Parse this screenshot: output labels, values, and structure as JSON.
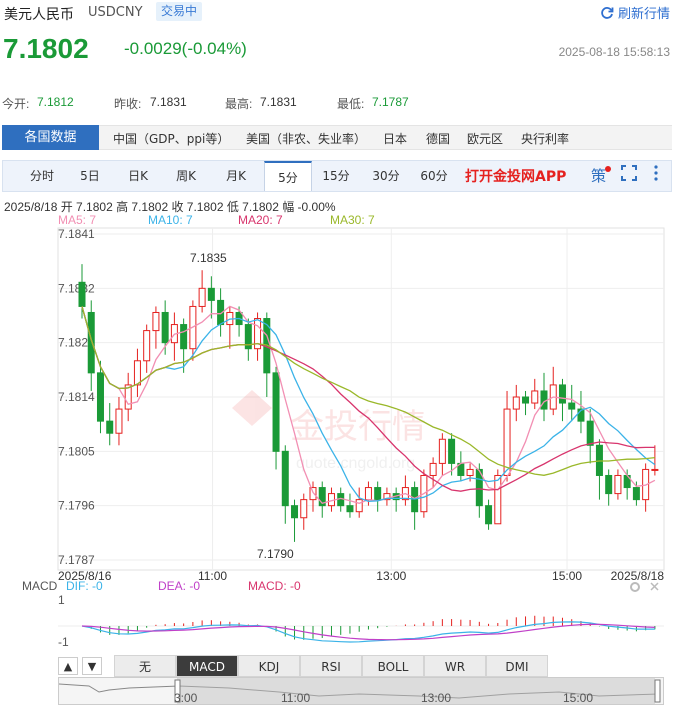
{
  "header": {
    "title": "美元人民币",
    "code": "USDCNY",
    "badge": "交易中",
    "refresh": "刷新行情"
  },
  "quote": {
    "price": "7.1802",
    "change": "-0.0029(-0.04%)",
    "timestamp": "2025-08-18 15:58:13"
  },
  "stats": {
    "open_label": "今开:",
    "open": "7.1812",
    "prev_label": "昨收:",
    "prev": "7.1831",
    "high_label": "最高:",
    "high": "7.1831",
    "low_label": "最低:",
    "low": "7.1787"
  },
  "nav": {
    "active": "各国数据",
    "items": [
      "中国（GDP、ppi等）",
      "美国（非农、失业率）",
      "日本",
      "德国",
      "欧元区",
      "央行利率"
    ]
  },
  "tabs": {
    "items": [
      "分时",
      "5日",
      "日K",
      "周K",
      "月K",
      "5分",
      "15分",
      "30分",
      "60分"
    ],
    "selected": "5分",
    "app": "打开金投网APP",
    "ce": "策"
  },
  "ohlc": "2025/8/18  开 7.1802  高 7.1802  收 7.1802  低 7.1802  幅 -0.00%",
  "ma": {
    "ma5": "MA5: 7",
    "ma10": "MA10: 7",
    "ma20": "MA20: 7",
    "ma30": "MA30: 7"
  },
  "colors": {
    "up": "#e5211f",
    "down": "#1a9a37",
    "ma5": "#f28fb3",
    "ma10": "#3bb3e8",
    "ma20": "#d8356d",
    "ma30": "#9ab82a"
  },
  "watermark": {
    "brand": "金投行情",
    "url": "quote.cngold.org"
  },
  "chart_data": {
    "type": "candlestick",
    "ylim": [
      7.1787,
      7.1841
    ],
    "y_ticks": [
      "7.1841",
      "7.1832",
      "7.1823",
      "7.1814",
      "7.1805",
      "7.1796",
      "7.1787"
    ],
    "x_labels": [
      "2025/8/16",
      "11:00",
      "13:00",
      "15:00",
      "2025/8/18"
    ],
    "annotations": {
      "high": "7.1835",
      "low": "7.1790"
    },
    "candles": [
      [
        7.1833,
        7.1829,
        7.1836,
        7.1827
      ],
      [
        7.1828,
        7.1818,
        7.183,
        7.1815
      ],
      [
        7.1818,
        7.181,
        7.182,
        7.1808
      ],
      [
        7.181,
        7.1808,
        7.1813,
        7.1806
      ],
      [
        7.1808,
        7.1812,
        7.1814,
        7.1806
      ],
      [
        7.1812,
        7.1816,
        7.1818,
        7.181
      ],
      [
        7.1816,
        7.182,
        7.1822,
        7.1814
      ],
      [
        7.182,
        7.1825,
        7.1826,
        7.1818
      ],
      [
        7.1825,
        7.1828,
        7.1829,
        7.1822
      ],
      [
        7.1828,
        7.1823,
        7.183,
        7.1821
      ],
      [
        7.1823,
        7.1826,
        7.1828,
        7.182
      ],
      [
        7.1826,
        7.1822,
        7.1827,
        7.1818
      ],
      [
        7.1822,
        7.1829,
        7.183,
        7.182
      ],
      [
        7.1829,
        7.1832,
        7.1835,
        7.1828
      ],
      [
        7.1832,
        7.183,
        7.1834,
        7.1827
      ],
      [
        7.183,
        7.1826,
        7.1832,
        7.1824
      ],
      [
        7.1826,
        7.1828,
        7.1829,
        7.1822
      ],
      [
        7.1828,
        7.1826,
        7.1829,
        7.1824
      ],
      [
        7.1826,
        7.1822,
        7.1827,
        7.182
      ],
      [
        7.1822,
        7.1827,
        7.1828,
        7.182
      ],
      [
        7.1827,
        7.1818,
        7.1828,
        7.1814
      ],
      [
        7.1818,
        7.1805,
        7.1819,
        7.1802
      ],
      [
        7.1805,
        7.1796,
        7.1806,
        7.1793
      ],
      [
        7.1796,
        7.1794,
        7.1797,
        7.179
      ],
      [
        7.1794,
        7.1797,
        7.1798,
        7.1792
      ],
      [
        7.1797,
        7.1799,
        7.18,
        7.1795
      ],
      [
        7.1799,
        7.1796,
        7.18,
        7.1794
      ],
      [
        7.1796,
        7.1798,
        7.1799,
        7.1795
      ],
      [
        7.1798,
        7.1796,
        7.1799,
        7.1795
      ],
      [
        7.1796,
        7.1795,
        7.1798,
        7.1794
      ],
      [
        7.1795,
        7.1797,
        7.1799,
        7.1794
      ],
      [
        7.1797,
        7.1799,
        7.18,
        7.1796
      ],
      [
        7.1799,
        7.1797,
        7.18,
        7.1795
      ],
      [
        7.1797,
        7.1798,
        7.1799,
        7.1796
      ],
      [
        7.1798,
        7.1797,
        7.1799,
        7.1795
      ],
      [
        7.1797,
        7.1799,
        7.1801,
        7.1796
      ],
      [
        7.1799,
        7.1795,
        7.18,
        7.1792
      ],
      [
        7.1795,
        7.1801,
        7.1802,
        7.1794
      ],
      [
        7.1801,
        7.1803,
        7.1804,
        7.1799
      ],
      [
        7.1803,
        7.1807,
        7.1808,
        7.1801
      ],
      [
        7.1807,
        7.1803,
        7.1808,
        7.1801
      ],
      [
        7.1803,
        7.1801,
        7.1805,
        7.18
      ],
      [
        7.1801,
        7.1802,
        7.1803,
        7.18
      ],
      [
        7.1802,
        7.1796,
        7.1803,
        7.1794
      ],
      [
        7.1796,
        7.1793,
        7.1797,
        7.1792
      ],
      [
        7.1793,
        7.1801,
        7.1802,
        7.1793
      ],
      [
        7.1801,
        7.1812,
        7.1815,
        7.18
      ],
      [
        7.1812,
        7.1814,
        7.1816,
        7.181
      ],
      [
        7.1814,
        7.1813,
        7.1815,
        7.1811
      ],
      [
        7.1813,
        7.1815,
        7.1817,
        7.1812
      ],
      [
        7.1815,
        7.1812,
        7.1818,
        7.181
      ],
      [
        7.1812,
        7.1816,
        7.1819,
        7.1811
      ],
      [
        7.1816,
        7.1813,
        7.1817,
        7.181
      ],
      [
        7.1813,
        7.1812,
        7.1816,
        7.181
      ],
      [
        7.1812,
        7.181,
        7.1815,
        7.1808
      ],
      [
        7.181,
        7.1806,
        7.1812,
        7.1803
      ],
      [
        7.1806,
        7.1801,
        7.1807,
        7.1797
      ],
      [
        7.1801,
        7.1798,
        7.1802,
        7.1796
      ],
      [
        7.1798,
        7.1801,
        7.1802,
        7.1797
      ],
      [
        7.1801,
        7.1799,
        7.1802,
        7.1797
      ],
      [
        7.1799,
        7.1797,
        7.18,
        7.1796
      ],
      [
        7.1797,
        7.1802,
        7.1803,
        7.1795
      ],
      [
        7.1802,
        7.1802,
        7.1806,
        7.1801
      ]
    ],
    "macd": {
      "label": "MACD",
      "dif": "DIF: -0",
      "dea": "DEA: -0",
      "macd": "MACD: -0",
      "ticks": [
        "1",
        "-1"
      ]
    }
  },
  "bottom": {
    "buttons": [
      "无",
      "MACD",
      "KDJ",
      "RSI",
      "BOLL",
      "WR",
      "DMI"
    ],
    "selected": "MACD",
    "up": "▲",
    "down": "▼",
    "nav_labels": [
      "3:00",
      "11:00",
      "13:00",
      "15:00"
    ]
  }
}
